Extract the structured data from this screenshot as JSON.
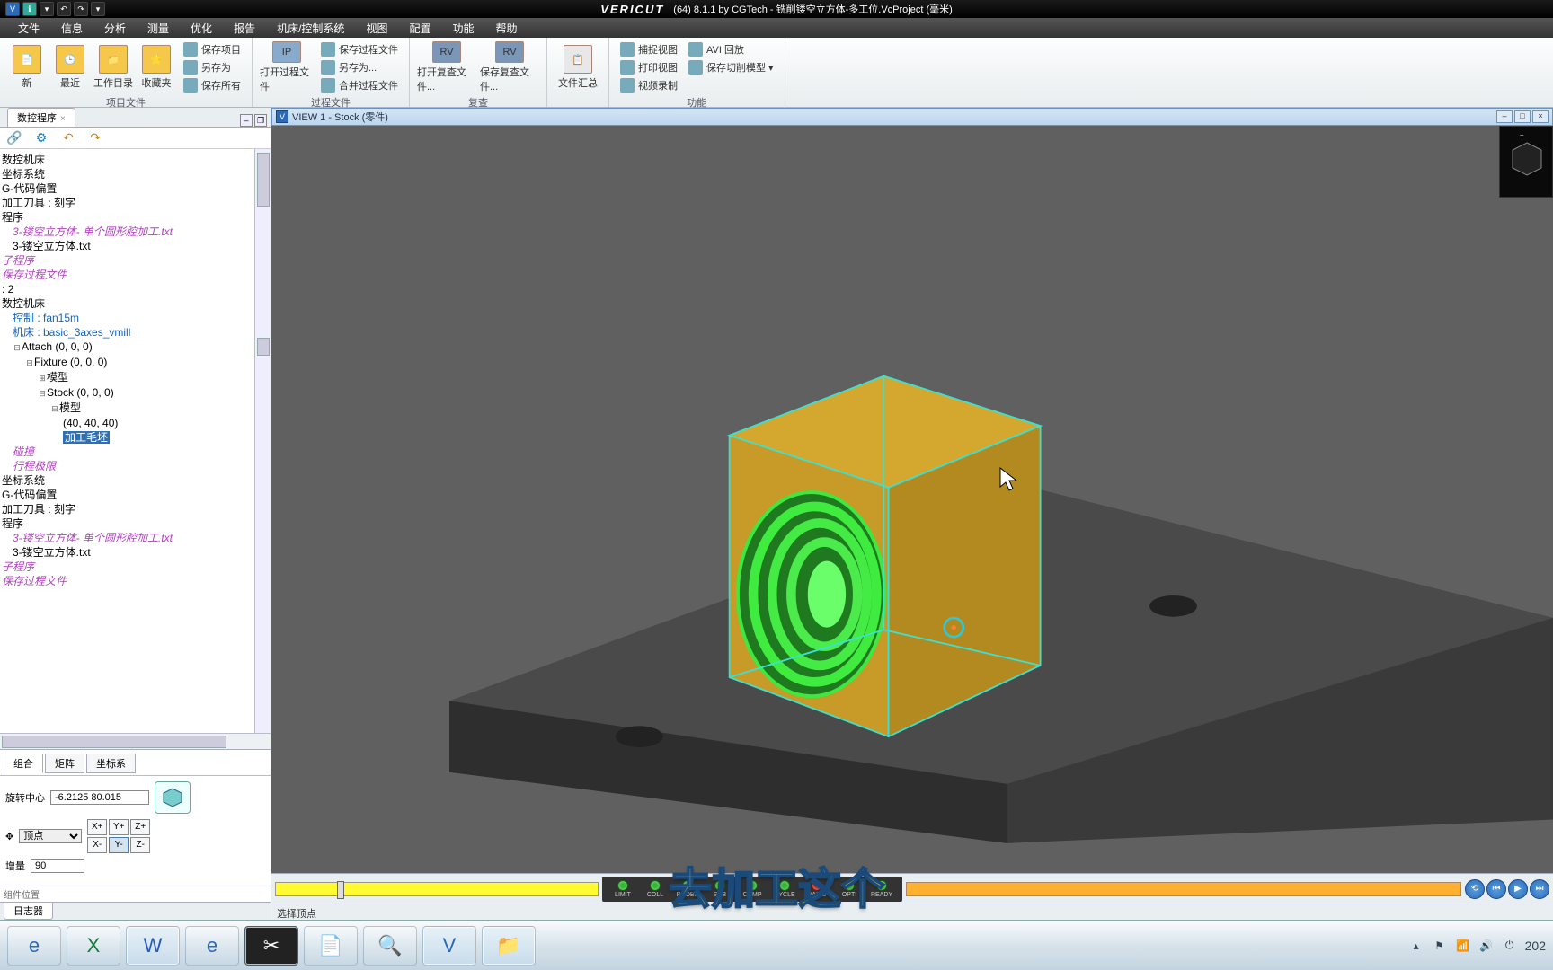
{
  "title": {
    "brand": "VERICUT",
    "suffix": "(64)  8.1.1 by CGTech - 铣削镂空立方体-多工位.VcProject (毫米)"
  },
  "menu": [
    "文件",
    "信息",
    "分析",
    "测量",
    "优化",
    "报告",
    "机床/控制系统",
    "视图",
    "配置",
    "功能",
    "帮助"
  ],
  "ribbon": {
    "groups": [
      {
        "label": "项目文件",
        "big": [
          {
            "label": "新",
            "name": "new-project"
          },
          {
            "label": "最近",
            "name": "recent"
          },
          {
            "label": "工作目录",
            "name": "workdir"
          },
          {
            "label": "收藏夹",
            "name": "favorites"
          }
        ],
        "small": [
          {
            "label": "保存项目",
            "name": "save-project"
          },
          {
            "label": "另存为",
            "name": "save-as"
          },
          {
            "label": "保存所有",
            "name": "save-all"
          }
        ]
      },
      {
        "label": "过程文件",
        "big": [
          {
            "label": "打开过程文件",
            "name": "open-proc"
          }
        ],
        "small": [
          {
            "label": "保存过程文件",
            "name": "save-proc"
          },
          {
            "label": "另存为...",
            "name": "save-proc-as"
          },
          {
            "label": "合并过程文件",
            "name": "merge-proc"
          }
        ]
      },
      {
        "label": "复查",
        "big": [
          {
            "label": "打开复查文件...",
            "name": "open-review"
          },
          {
            "label": "保存复查文件...",
            "name": "save-review"
          }
        ]
      },
      {
        "label": "",
        "big": [
          {
            "label": "文件汇总",
            "name": "file-summary"
          }
        ]
      },
      {
        "label": "功能",
        "small": [
          {
            "label": "捕捉视图",
            "name": "capture-view"
          },
          {
            "label": "打印视图",
            "name": "print-view"
          },
          {
            "label": "视频录制",
            "name": "record-video"
          }
        ],
        "small2": [
          {
            "label": "AVI 回放",
            "name": "avi-playback"
          },
          {
            "label": "保存切削模型 ▾",
            "name": "save-cut-model"
          }
        ]
      }
    ]
  },
  "left_panel": {
    "tab": "数控程序",
    "toolbar_icons": [
      "link-icon",
      "gear-icon",
      "undo-icon",
      "redo-icon"
    ],
    "tree": [
      {
        "lvl": 0,
        "text": "数控机床"
      },
      {
        "lvl": 0,
        "text": "坐标系统"
      },
      {
        "lvl": 0,
        "text": "G-代码偏置"
      },
      {
        "lvl": 0,
        "text": "加工刀具 : 刻字"
      },
      {
        "lvl": 0,
        "text": "程序"
      },
      {
        "lvl": 1,
        "text": "3-镂空立方体- 单个圆形腔加工.txt",
        "link": true
      },
      {
        "lvl": 1,
        "text": "3-镂空立方体.txt"
      },
      {
        "lvl": 0,
        "text": "子程序",
        "link": true
      },
      {
        "lvl": 0,
        "text": "保存过程文件",
        "link": true
      },
      {
        "lvl": 0,
        "text": ": 2"
      },
      {
        "lvl": 0,
        "text": "数控机床"
      },
      {
        "lvl": 1,
        "text": "控制 : fan15m",
        "color": "#1762b8"
      },
      {
        "lvl": 1,
        "text": "机床 : basic_3axes_vmill",
        "color": "#1762b8"
      },
      {
        "lvl": 1,
        "text": "Attach (0, 0, 0)",
        "tw": "−"
      },
      {
        "lvl": 2,
        "text": "Fixture (0, 0, 0)",
        "tw": "−"
      },
      {
        "lvl": 3,
        "text": "模型",
        "tw": "+"
      },
      {
        "lvl": 3,
        "text": "Stock (0, 0, 0)",
        "tw": "−"
      },
      {
        "lvl": 4,
        "text": "模型",
        "tw": "−"
      },
      {
        "lvl": 5,
        "text": "(40, 40, 40)"
      },
      {
        "lvl": 5,
        "text": "加工毛坯",
        "sel": true
      },
      {
        "lvl": 1,
        "text": "碰撞",
        "link": true
      },
      {
        "lvl": 1,
        "text": "行程极限",
        "link": true
      },
      {
        "lvl": 0,
        "text": "坐标系统"
      },
      {
        "lvl": 0,
        "text": "G-代码偏置"
      },
      {
        "lvl": 0,
        "text": "加工刀具 : 刻字"
      },
      {
        "lvl": 0,
        "text": "程序"
      },
      {
        "lvl": 1,
        "text": "3-镂空立方体- 单个圆形腔加工.txt",
        "link": true
      },
      {
        "lvl": 1,
        "text": "3-镂空立方体.txt"
      },
      {
        "lvl": 0,
        "text": "子程序",
        "link": true
      },
      {
        "lvl": 0,
        "text": "保存过程文件",
        "link": true
      }
    ],
    "props": {
      "tabs": [
        "组合",
        "矩阵",
        "坐标系"
      ],
      "rotate_label": "旋转中心",
      "rotate_value": "-6.2125 80.015",
      "vertex_select": "顶点",
      "increment_label": "增量",
      "increment_value": "90",
      "axes": [
        "X+",
        "Y+",
        "Z+",
        "X-",
        "Y-",
        "Z-"
      ]
    },
    "bottom_tab": "日志器",
    "component_pos": "组件位置"
  },
  "viewport": {
    "title": "VIEW 1 - Stock (零件)",
    "status_line": "选择顶点"
  },
  "leds": [
    "LIMIT",
    "COLL",
    "PROBE",
    "SUB",
    "COMP",
    "CYCLE",
    "RAPID",
    "OPTI",
    "READY"
  ],
  "caption": "去加工这个",
  "taskbar": {
    "clock": "202"
  }
}
